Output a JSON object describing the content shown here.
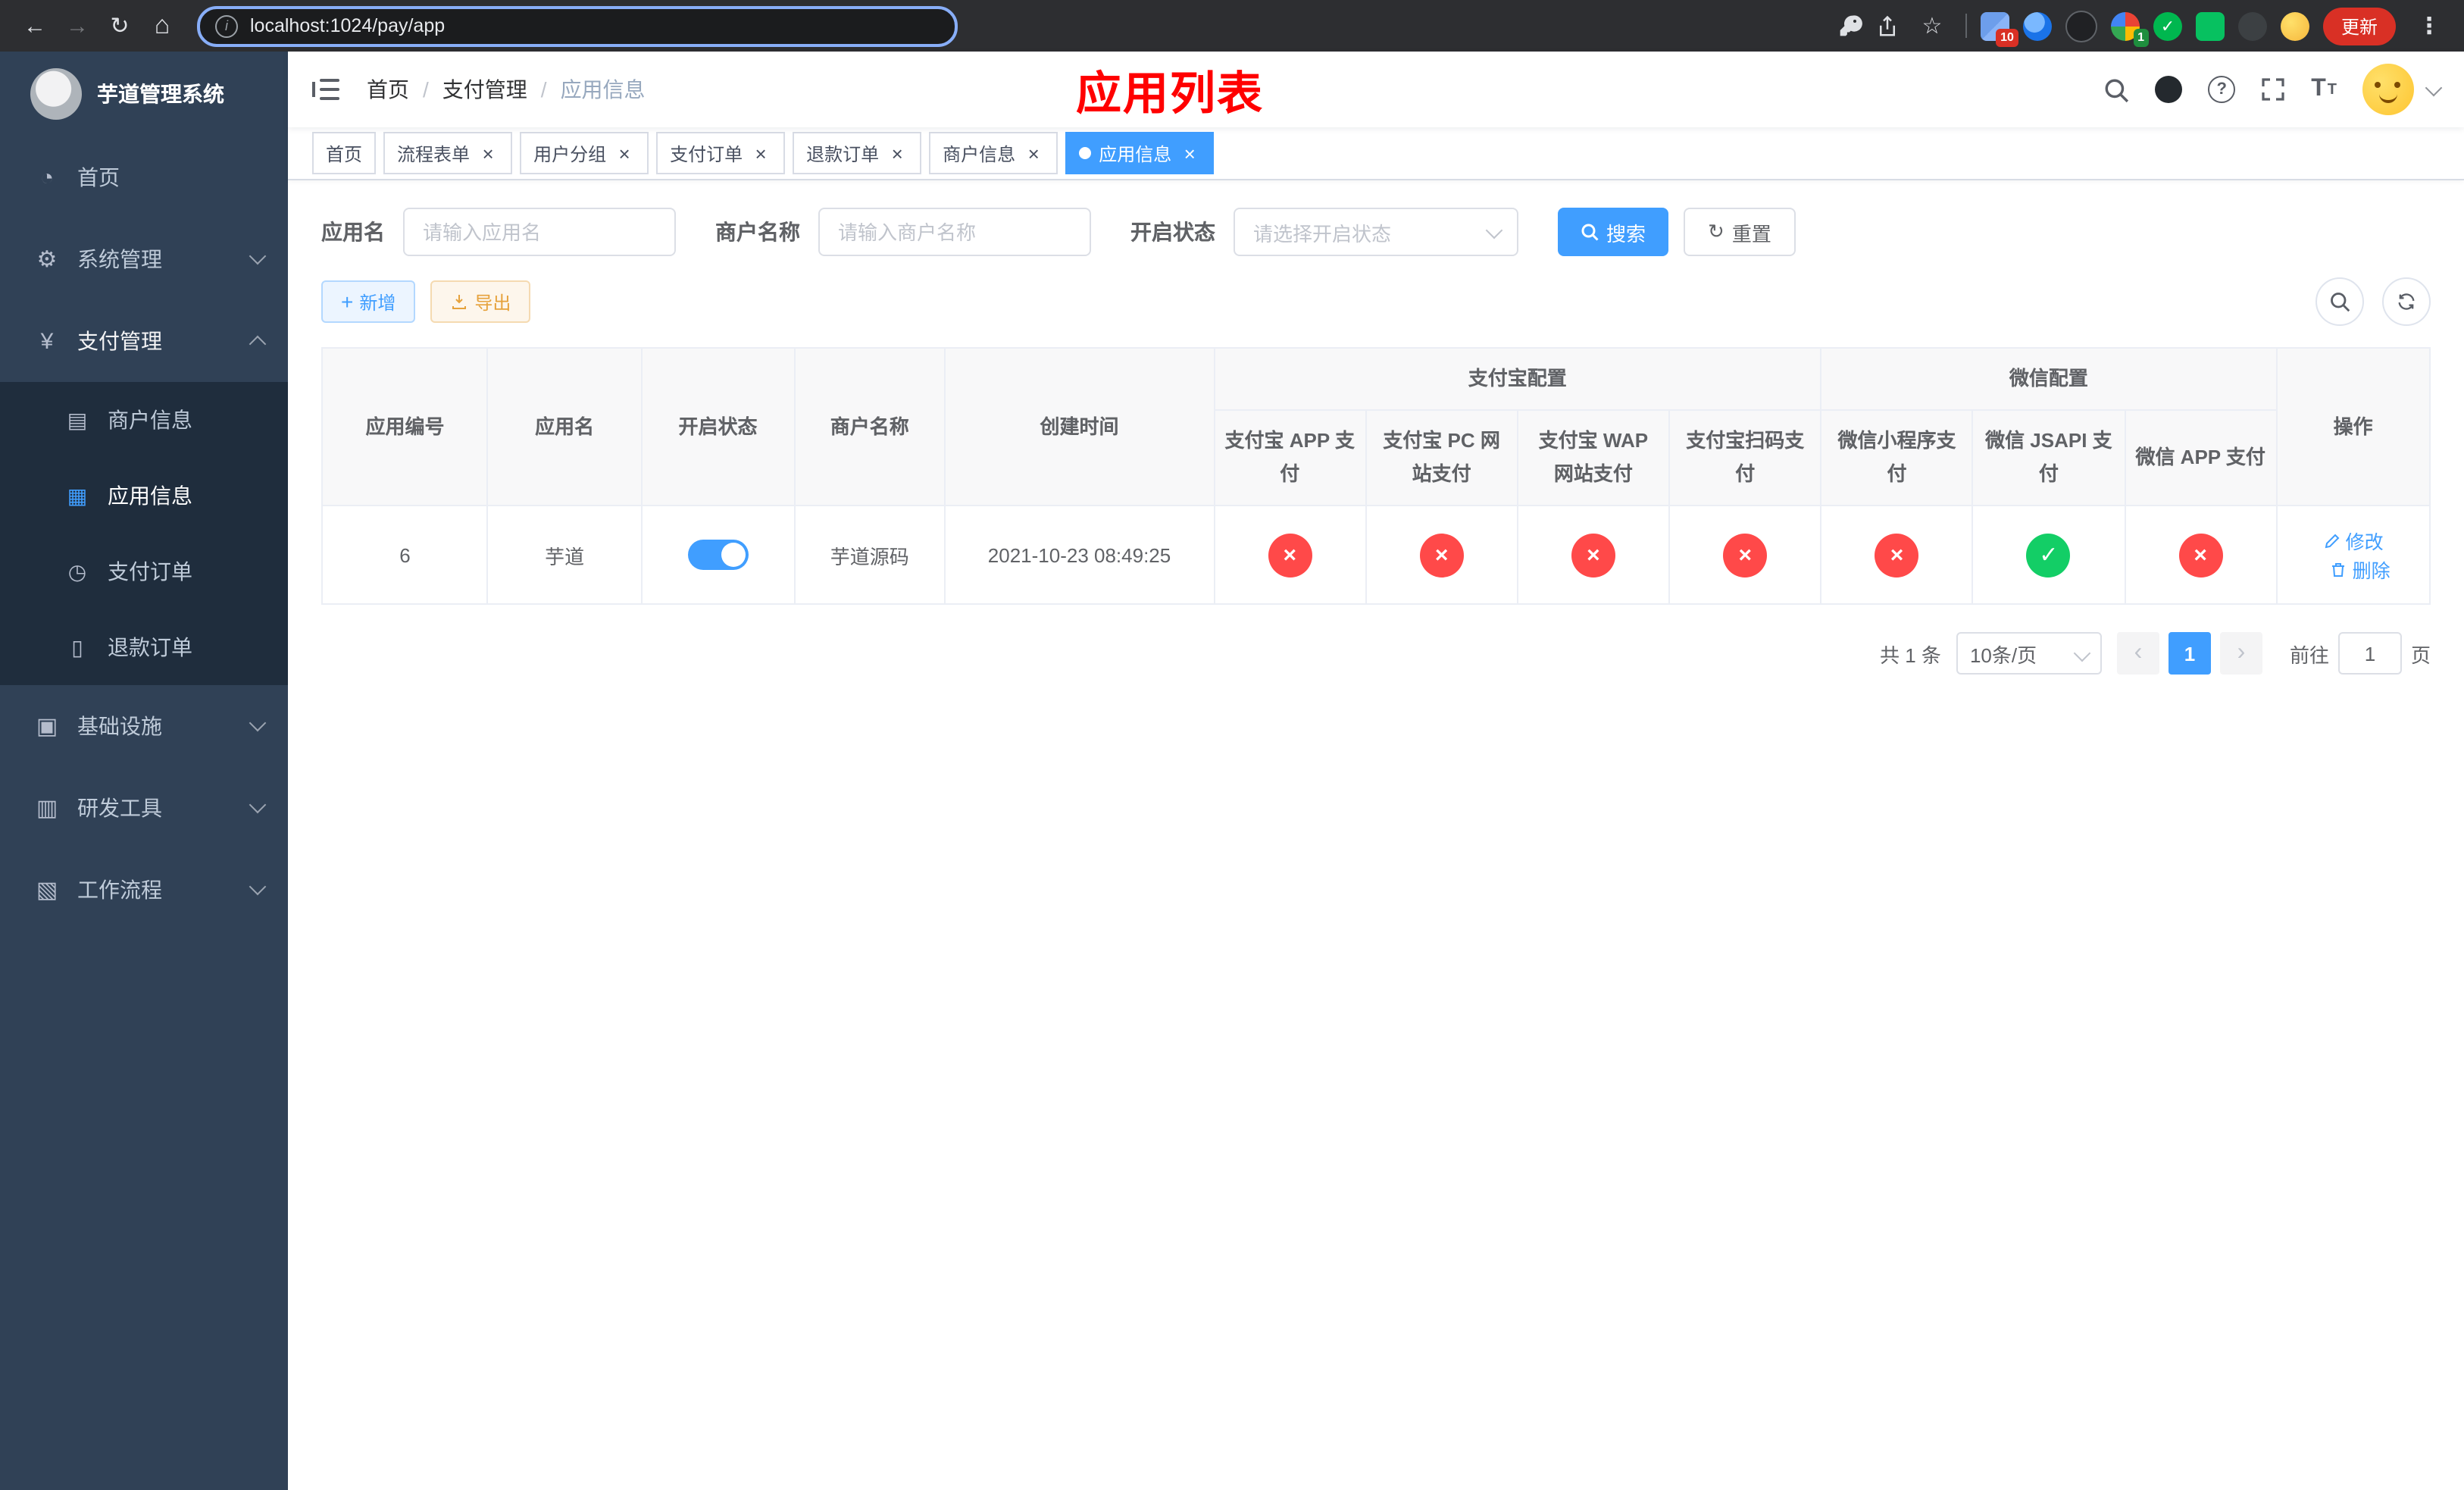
{
  "colors": {
    "accent": "#409eff",
    "danger": "#ff4949",
    "success": "#13ce66",
    "warning": "#e6a23c",
    "annotation": "#ff0000",
    "sidebar_bg": "#304156",
    "submenu_bg": "#1f2d3d",
    "update_btn_bg": "#d93025"
  },
  "browser": {
    "url": "localhost:1024/pay/app",
    "update_label": "更新",
    "ext_badge_1": "10",
    "ext_badge_2": "1"
  },
  "sidebar": {
    "title": "芋道管理系统",
    "menu": [
      {
        "label": "首页"
      },
      {
        "label": "系统管理"
      },
      {
        "label": "支付管理"
      },
      {
        "label": "基础设施"
      },
      {
        "label": "研发工具"
      },
      {
        "label": "工作流程"
      }
    ],
    "submenu": [
      {
        "label": "商户信息"
      },
      {
        "label": "应用信息"
      },
      {
        "label": "支付订单"
      },
      {
        "label": "退款订单"
      }
    ]
  },
  "header": {
    "breadcrumb": [
      "首页",
      "支付管理",
      "应用信息"
    ],
    "annotation": "应用列表"
  },
  "tabs": [
    {
      "label": "首页"
    },
    {
      "label": "流程表单"
    },
    {
      "label": "用户分组"
    },
    {
      "label": "支付订单"
    },
    {
      "label": "退款订单"
    },
    {
      "label": "商户信息"
    },
    {
      "label": "应用信息"
    }
  ],
  "filters": {
    "app_name_label": "应用名",
    "app_name_placeholder": "请输入应用名",
    "merchant_label": "商户名称",
    "merchant_placeholder": "请输入商户名称",
    "status_label": "开启状态",
    "status_placeholder": "请选择开启状态",
    "search_label": "搜索",
    "reset_label": "重置"
  },
  "toolbar": {
    "add_label": "新增",
    "export_label": "导出"
  },
  "table": {
    "groups": {
      "alipay": "支付宝配置",
      "wechat": "微信配置"
    },
    "columns": {
      "id": "应用编号",
      "name": "应用名",
      "status": "开启状态",
      "merchant": "商户名称",
      "created": "创建时间",
      "alipay_app": "支付宝 APP 支付",
      "alipay_pc": "支付宝 PC 网站支付",
      "alipay_wap": "支付宝 WAP 网站支付",
      "alipay_qr": "支付宝扫码支付",
      "wechat_lite": "微信小程序支付",
      "wechat_jsapi": "微信 JSAPI 支付",
      "wechat_app": "微信 APP 支付",
      "actions": "操作"
    },
    "rows": [
      {
        "id": "6",
        "name": "芋道",
        "enabled": true,
        "merchant": "芋道源码",
        "created": "2021-10-23 08:49:25",
        "pay_status": [
          false,
          false,
          false,
          false,
          false,
          true,
          false
        ],
        "edit_label": "修改",
        "delete_label": "删除"
      }
    ]
  },
  "pagination": {
    "total_text": "共 1 条",
    "page_size_text": "10条/页",
    "current_page": "1",
    "goto_label": "前往",
    "goto_value": "1",
    "page_unit": "页"
  }
}
